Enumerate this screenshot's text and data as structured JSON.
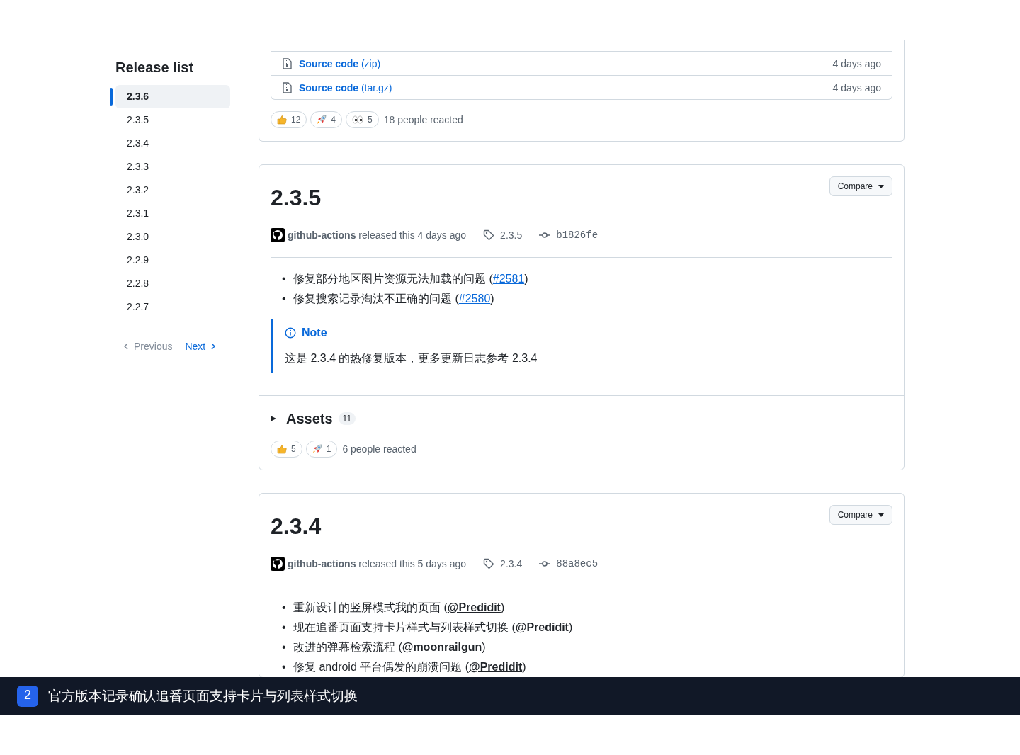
{
  "sidebar": {
    "title": "Release list",
    "items": [
      {
        "label": "2.3.6",
        "selected": true
      },
      {
        "label": "2.3.5",
        "selected": false
      },
      {
        "label": "2.3.4",
        "selected": false
      },
      {
        "label": "2.3.3",
        "selected": false
      },
      {
        "label": "2.3.2",
        "selected": false
      },
      {
        "label": "2.3.1",
        "selected": false
      },
      {
        "label": "2.3.0",
        "selected": false
      },
      {
        "label": "2.2.9",
        "selected": false
      },
      {
        "label": "2.2.8",
        "selected": false
      },
      {
        "label": "2.2.7",
        "selected": false
      }
    ],
    "previous": {
      "label": "Previous",
      "disabled": true
    },
    "next": {
      "label": "Next",
      "disabled": false
    }
  },
  "releases": [
    {
      "kind": "tail",
      "assets": [
        {
          "name": "Source code",
          "suffix": "(zip)",
          "date": "4 days ago"
        },
        {
          "name": "Source code",
          "suffix": "(tar.gz)",
          "date": "4 days ago"
        }
      ],
      "reactions": [
        {
          "kind": "thumbs-up",
          "count": "12"
        },
        {
          "kind": "rocket",
          "count": "4"
        },
        {
          "kind": "eyes",
          "count": "5"
        }
      ],
      "reacted": "18 people reacted"
    },
    {
      "kind": "full",
      "title": "2.3.5",
      "compare": "Compare",
      "author": "github-actions",
      "released": "released this 4 days ago",
      "tag": "2.3.5",
      "commit": "b1826fe",
      "notes": [
        {
          "marker": "•",
          "text": "修复部分地区图片资源无法加载的问题 (",
          "link": "#2581",
          "kind": "issue",
          "after": ")"
        },
        {
          "marker": "•",
          "text": "修复搜索记录淘汰不正确的问题 (",
          "link": "#2580",
          "kind": "issue",
          "after": ")"
        }
      ],
      "callout": {
        "title": "Note",
        "text": "这是 2.3.4 的热修复版本，更多更新日志参考 2.3.4"
      },
      "assets": {
        "label": "Assets",
        "count": "11",
        "expanded": false
      },
      "reactions": [
        {
          "kind": "thumbs-up",
          "count": "5"
        },
        {
          "kind": "rocket",
          "count": "1"
        }
      ],
      "reacted": "6 people reacted"
    },
    {
      "kind": "full",
      "title": "2.3.4",
      "compare": "Compare",
      "author": "github-actions",
      "released": "released this 5 days ago",
      "tag": "2.3.4",
      "commit": "88a8ec5",
      "notes": [
        {
          "marker": "•",
          "text": "重新设计的竖屏模式我的页面 (",
          "link": "@Predidit",
          "kind": "mention",
          "after": ")"
        },
        {
          "marker": "•",
          "text": "现在追番页面支持卡片样式与列表样式切换 (",
          "link": "@Predidit",
          "kind": "mention",
          "after": ")"
        },
        {
          "marker": "•",
          "text": "改进的弹幕检索流程 (",
          "link": "@moonrailgun",
          "kind": "mention",
          "after": ")"
        },
        {
          "marker": "•",
          "text": "修复 android 平台偶发的崩溃问题 (",
          "link": "@Predidit",
          "kind": "mention",
          "after": ")"
        }
      ]
    }
  ],
  "caption": {
    "number": "2",
    "text": "官方版本记录确认追番页面支持卡片与列表样式切换"
  }
}
